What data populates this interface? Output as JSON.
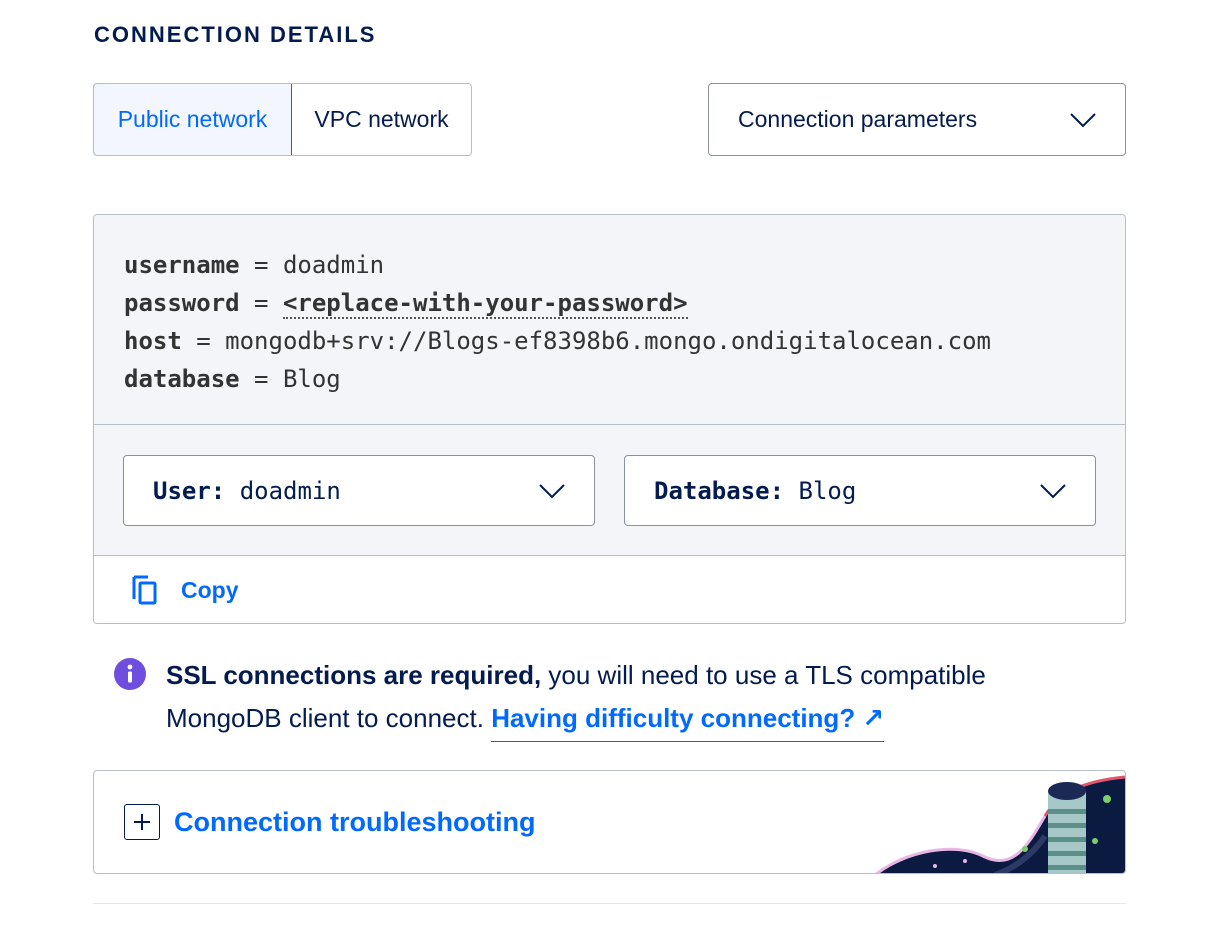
{
  "section": {
    "title": "CONNECTION DETAILS"
  },
  "network": {
    "public_label": "Public network",
    "vpc_label": "VPC network"
  },
  "params_dropdown": {
    "label": "Connection parameters"
  },
  "connection": {
    "username_key": "username",
    "username_value": "doadmin",
    "password_key": "password",
    "password_value": "<replace-with-your-password>",
    "host_key": "host",
    "host_value": "mongodb+srv://Blogs-ef8398b6.mongo.ondigitalocean.com",
    "database_key": "database",
    "database_value": "Blog",
    "equals": "="
  },
  "user_select": {
    "label": "User:",
    "value": "doadmin"
  },
  "database_select": {
    "label": "Database:",
    "value": "Blog"
  },
  "copy": {
    "label": "Copy"
  },
  "ssl_notice": {
    "strong": "SSL connections are required,",
    "text": " you will need to use a TLS compatible MongoDB client to connect. ",
    "link": "Having difficulty connecting? ↗"
  },
  "troubleshooting": {
    "title": "Connection troubleshooting"
  },
  "colors": {
    "primary": "#0069ff",
    "text": "#031b4e",
    "info": "#6f4dde",
    "code_bg": "#f3f5f9",
    "border": "#b5bfc9"
  }
}
